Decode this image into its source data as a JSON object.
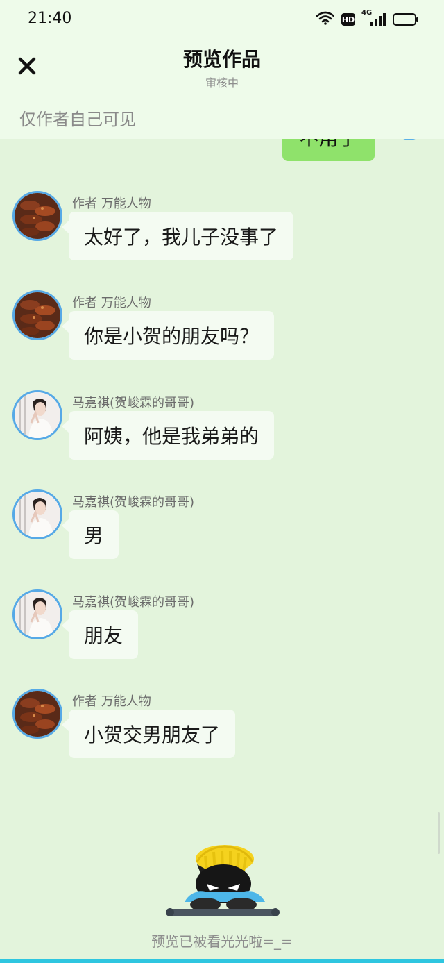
{
  "status_bar": {
    "time": "21:40",
    "hd_label": "HD",
    "network_label": "4G",
    "icons": [
      "wifi-icon",
      "hd-icon",
      "signal-4g-icon",
      "battery-icon"
    ]
  },
  "header": {
    "title": "预览作品",
    "subtitle": "审核中",
    "close_icon": "close-icon",
    "visibility_note": "仅作者自己可见"
  },
  "partial_message": {
    "text": "不用了"
  },
  "messages": [
    {
      "sender": "作者 万能人物",
      "text": "太好了，我儿子没事了",
      "avatar": "food-avatar"
    },
    {
      "sender": "作者 万能人物",
      "text": "你是小贺的朋友吗？",
      "avatar": "food-avatar"
    },
    {
      "sender": "马嘉祺(贺峻霖的哥哥)",
      "text": "阿姨，他是我弟弟的",
      "avatar": "person-avatar"
    },
    {
      "sender": "马嘉祺(贺峻霖的哥哥)",
      "text": "男",
      "avatar": "person-avatar"
    },
    {
      "sender": "马嘉祺(贺峻霖的哥哥)",
      "text": "朋友",
      "avatar": "person-avatar"
    },
    {
      "sender": "作者 万能人物",
      "text": "小贺交男朋友了",
      "avatar": "food-avatar"
    }
  ],
  "footer": {
    "text": "预览已被看光光啦=_=",
    "mascot_icon": "mascot-icon"
  },
  "colors": {
    "background": "#e3f4dc",
    "header_background": "#eefbea",
    "bubble": "#f4fbf2",
    "self_bubble": "#8fe26b",
    "avatar_ring": "#56a9e6",
    "bottom_line": "#2ec6e0"
  }
}
